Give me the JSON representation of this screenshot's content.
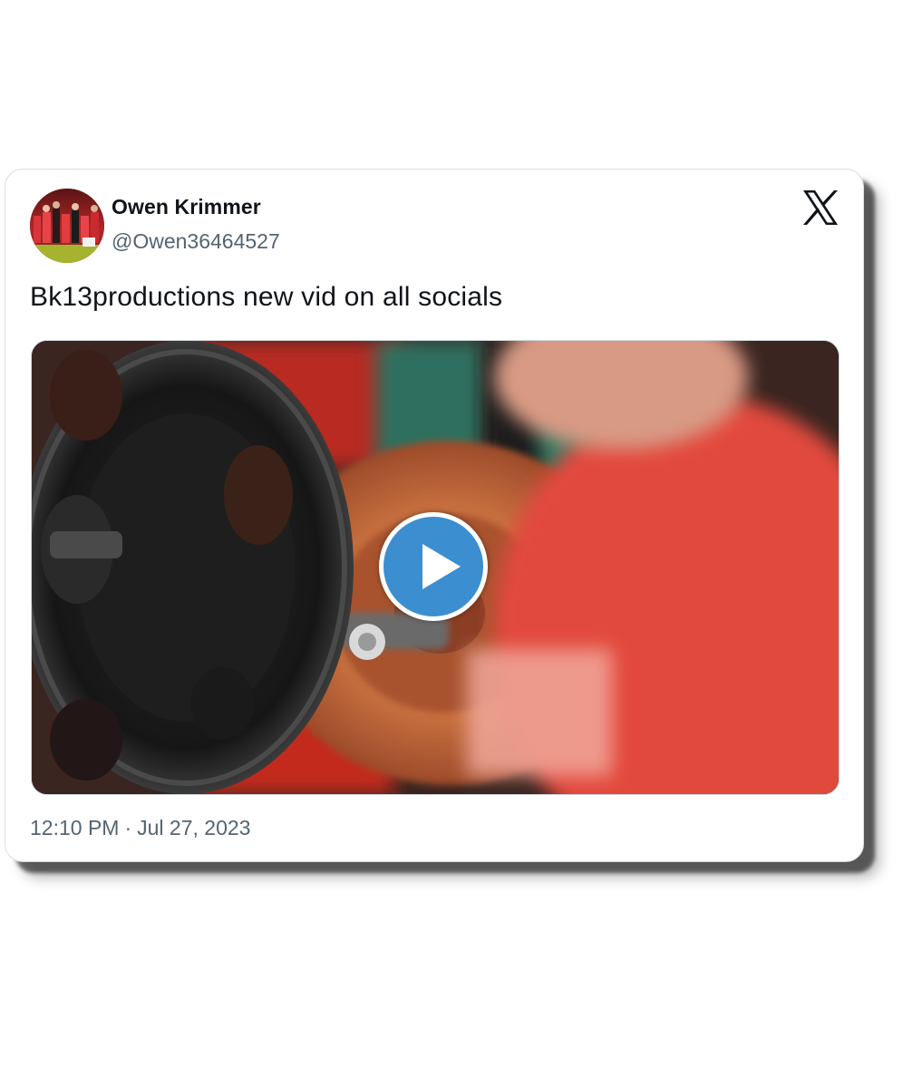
{
  "tweet": {
    "author_name": "Owen Krimmer",
    "author_handle": "@Owen36464527",
    "text": "Bk13productions new vid on all socials",
    "time": "12:10 PM",
    "separator": "·",
    "date": "Jul 27, 2023"
  },
  "media": {
    "type": "video",
    "play_icon": "play-icon"
  },
  "icons": {
    "platform_logo": "x-logo-icon",
    "avatar": "avatar-image"
  },
  "colors": {
    "text_primary": "#0f1419",
    "text_secondary": "#536471",
    "play_button": "#3b8ed0",
    "card_border": "#d9dde1"
  }
}
